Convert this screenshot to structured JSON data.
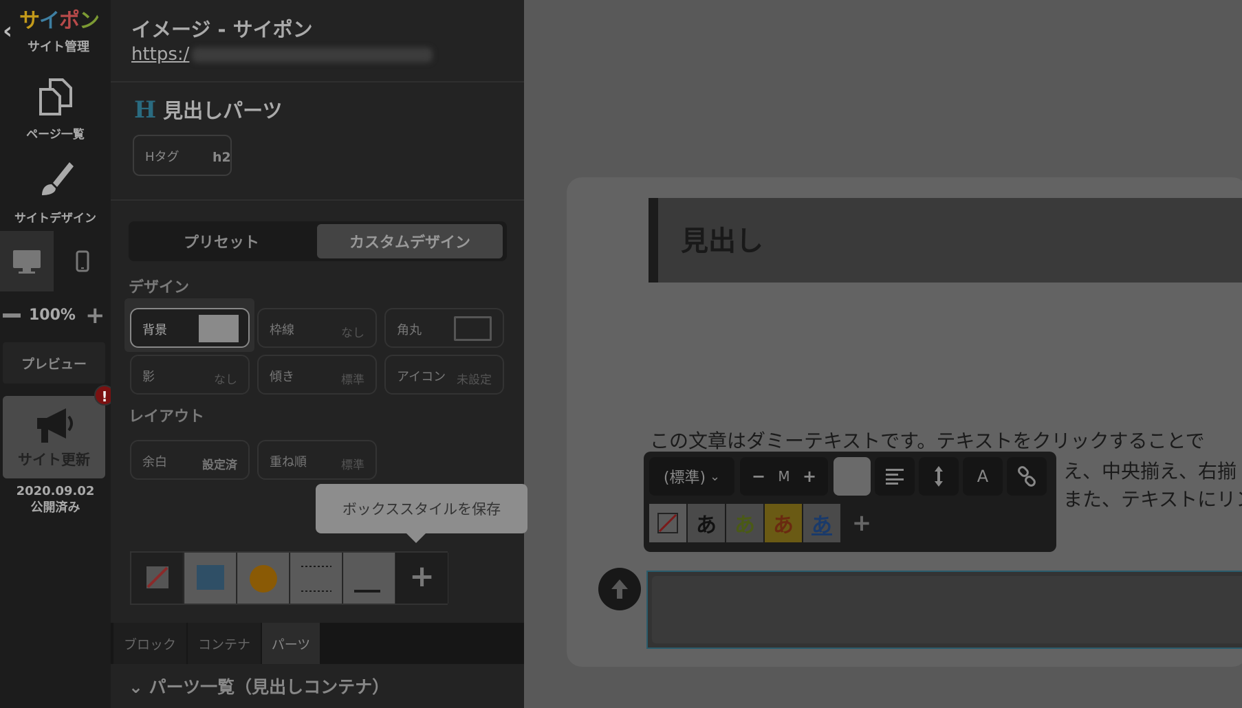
{
  "nav": {
    "back_icon": "chevron-left-icon",
    "brand_chars": [
      "サ",
      "イ",
      "ポ",
      "ン"
    ],
    "brand_sub": "サイト管理",
    "pages_label": "ページ一覧",
    "design_label": "サイトデザイン",
    "zoom_value": "100%",
    "preview_label": "プレビュー",
    "update_label": "サイト更新",
    "update_badge": "!",
    "date": "2020.09.02",
    "status": "公開済み"
  },
  "panel": {
    "page_title": "イメージ - サイポン",
    "url_visible": "https:/",
    "part_icon": "H",
    "part_title": "見出しパーツ",
    "htag_label": "Hタグ",
    "htag_value": "h2",
    "tab_preset": "プリセット",
    "tab_custom": "カスタムデザイン",
    "section_design": "デザイン",
    "section_layout": "レイアウト",
    "options": {
      "bg": {
        "label": "背景",
        "swatch_color": "#8a8a8a"
      },
      "border": {
        "label": "枠線",
        "value": "なし"
      },
      "radius": {
        "label": "角丸"
      },
      "shadow": {
        "label": "影",
        "value": "なし"
      },
      "tilt": {
        "label": "傾き",
        "value": "標準"
      },
      "icon": {
        "label": "アイコン",
        "value": "未設定"
      },
      "margin": {
        "label": "余白",
        "value": "設定済"
      },
      "order": {
        "label": "重ね順",
        "value": "標準"
      }
    },
    "tooltip": "ボックススタイルを保存",
    "styles_add": "+",
    "bottom_tabs": [
      "ブロック",
      "コンテナ",
      "パーツ"
    ],
    "parts_list": "パーツ一覧（見出しコンテナ）"
  },
  "canvas": {
    "heading": "見出し",
    "body_lines": [
      "この文章はダミーテキストです。テキストをクリックすることで",
      "え、中央揃え、右揃",
      "また、テキストにリン"
    ],
    "toolbar": {
      "font_select": "(標準)",
      "size_minus": "−",
      "size_value": "M",
      "size_plus": "+",
      "bold_label": "A",
      "char_styles": [
        "あ",
        "あ",
        "あ",
        "あ"
      ],
      "add": "+"
    }
  }
}
